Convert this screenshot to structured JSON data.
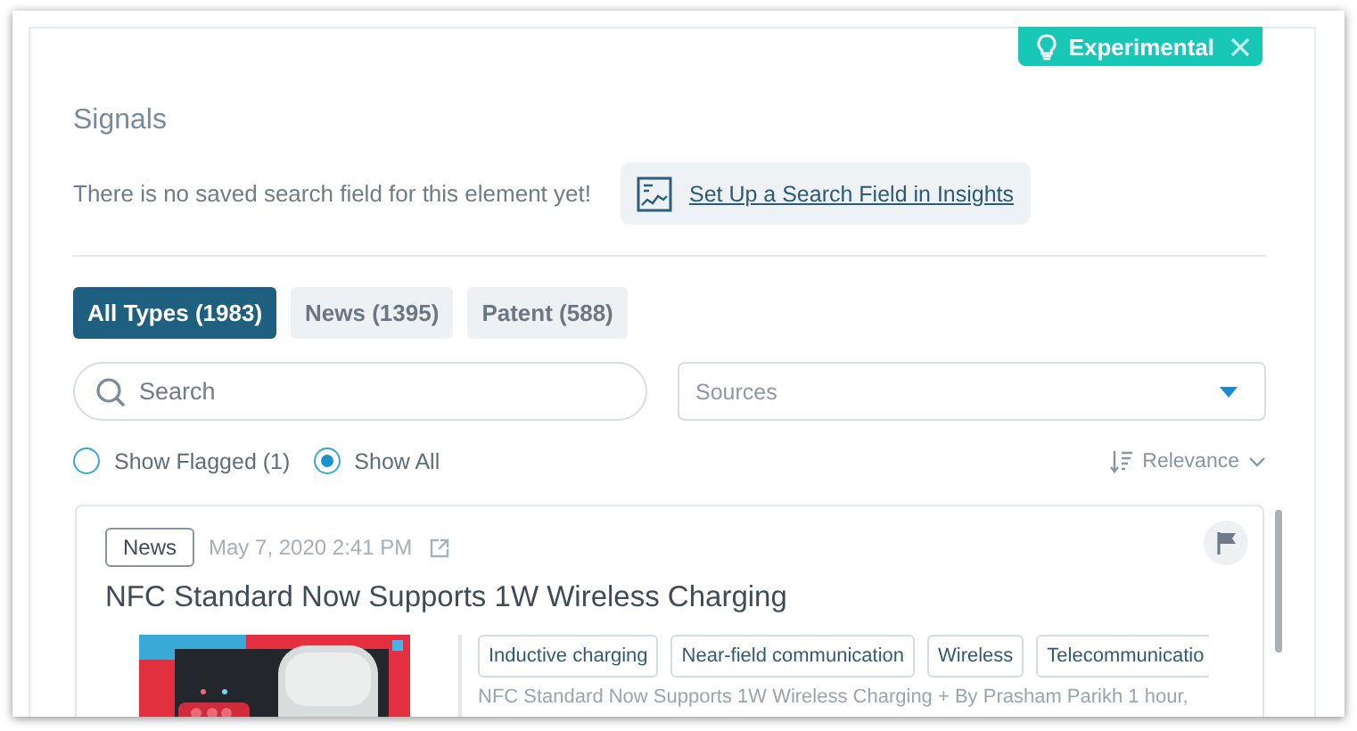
{
  "badge": {
    "label": "Experimental"
  },
  "title": "Signals",
  "notice": {
    "text": "There is no saved search field for this element yet!",
    "link": "Set Up a Search Field in Insights"
  },
  "tabs": [
    {
      "label": "All Types (1983)",
      "selected": true
    },
    {
      "label": "News (1395)",
      "selected": false
    },
    {
      "label": "Patent (588)",
      "selected": false
    }
  ],
  "search": {
    "placeholder": "Search"
  },
  "sources": {
    "placeholder": "Sources"
  },
  "filters": [
    {
      "label": "Show Flagged (1)",
      "selected": false
    },
    {
      "label": "Show All",
      "selected": true
    }
  ],
  "sort": {
    "label": "Relevance"
  },
  "results": [
    {
      "type": "News",
      "date": "May 7, 2020 2:41 PM",
      "flagged": false,
      "title": "NFC Standard Now Supports 1W Wireless Charging",
      "tags": [
        "Inductive charging",
        "Near-field communication",
        "Wireless",
        "Telecommunicatio"
      ],
      "snippet": "NFC Standard Now Supports 1W Wireless Charging + By Prasham Parikh 1 hour,"
    }
  ]
}
